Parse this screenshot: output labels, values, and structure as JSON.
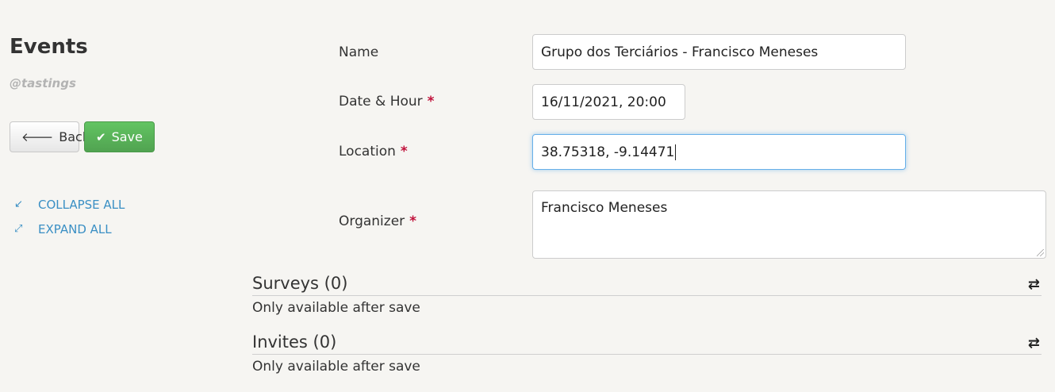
{
  "sidebar": {
    "title": "Events",
    "subtitle": "@tastings",
    "back_label": "Back",
    "save_label": "Save",
    "collapse_label": "COLLAPSE ALL",
    "expand_label": "EXPAND ALL"
  },
  "form": {
    "name": {
      "label": "Name",
      "value": "Grupo dos Terciários - Francisco Meneses"
    },
    "date": {
      "label": "Date & Hour",
      "value": "16/11/2021, 20:00"
    },
    "location": {
      "label": "Location",
      "value": "38.75318, -9.14471"
    },
    "organizer": {
      "label": "Organizer",
      "value": "Francisco Meneses"
    },
    "required_mark": "*"
  },
  "sections": {
    "surveys": {
      "title": "Surveys (0)",
      "note": "Only available after save"
    },
    "invites": {
      "title": "Invites (0)",
      "note": "Only available after save"
    }
  },
  "icons": {
    "back": "arrow-left-icon",
    "save": "check-icon",
    "collapse": "compress-icon",
    "expand": "expand-icon",
    "refresh": "refresh-icon"
  },
  "colors": {
    "save_green": "#5bb75b",
    "link_blue": "#3a8fc4",
    "required_red": "#c0103a",
    "focus_blue": "#66afe9"
  }
}
